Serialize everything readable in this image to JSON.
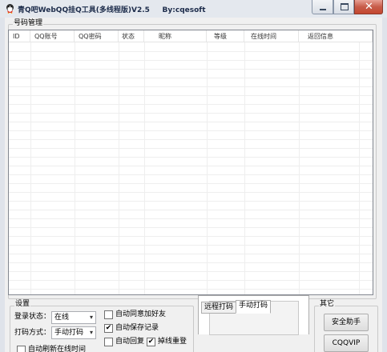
{
  "window": {
    "title": "青Q吧WebQQ挂Q工具(多线程版)V2.5     By:cqesoft",
    "minimize_icon": "minimize-icon",
    "maximize_icon": "maximize-icon",
    "close_icon": "close-icon",
    "close_glyph": "✕"
  },
  "account_group": {
    "label": "号码管理",
    "columns": [
      "ID",
      "QQ账号",
      "QQ密码",
      "状态",
      "昵称",
      "等级",
      "在线时间",
      "返回信息"
    ],
    "rows": []
  },
  "settings": {
    "label": "设置",
    "login_status_label": "登录状态：",
    "login_status_value": "在线",
    "captcha_mode_label": "打码方式：",
    "captcha_mode_value": "手动打码",
    "auto_refresh_label": "自动刷新在线时间",
    "auto_refresh_checked": false,
    "auto_accept_friend_label": "自动同意加好友",
    "auto_accept_friend_checked": false,
    "auto_save_log_label": "自动保存记录",
    "auto_save_log_checked": true,
    "auto_reply_label": "自动回复",
    "auto_reply_checked": false,
    "reconnect_label": "掉线重登",
    "reconnect_checked": true,
    "check_mark": "✔"
  },
  "captcha_tabs": {
    "tabs": [
      "远程打码",
      "手动打码"
    ],
    "active_tab": "手动打码"
  },
  "other_group": {
    "label": "其它",
    "safety_button": "安全助手",
    "vip_button": "CQQVIP"
  }
}
